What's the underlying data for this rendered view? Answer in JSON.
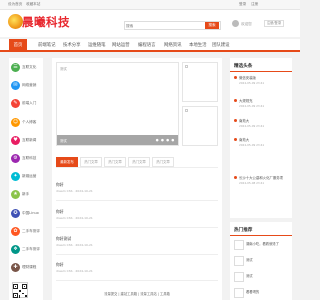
{
  "topbar": {
    "left1": "设为首页",
    "left2": "收藏本站",
    "login": "登录",
    "register": "注册"
  },
  "header": {
    "brand": "晨曦科技",
    "search_placeholder": "搜索",
    "search_button": "搜索",
    "user_text": "欢迎您",
    "user_button": "注册/登录"
  },
  "nav": {
    "items": [
      "首页",
      "前端笔记",
      "技术分享",
      "运维随笔",
      "网站运营",
      "编程语言",
      "网络资讯",
      "本地生活",
      "团队建设"
    ]
  },
  "sidebar": {
    "items": [
      {
        "label": "互联文化",
        "color": "#4caf50",
        "glyph": "☰"
      },
      {
        "label": "网络营销",
        "color": "#2196f3",
        "glyph": "✉"
      },
      {
        "label": "前端入门",
        "color": "#f44336",
        "glyph": "✎"
      },
      {
        "label": "个人博客",
        "color": "#ff9800",
        "glyph": "☺"
      },
      {
        "label": "互联新闻",
        "color": "#e91e63",
        "glyph": "♥"
      },
      {
        "label": "互联科技",
        "color": "#9c27b0",
        "glyph": "⚙"
      },
      {
        "label": "新媒运营",
        "color": "#00bcd4",
        "glyph": "✦"
      },
      {
        "label": "新手",
        "color": "#8bc34a",
        "glyph": "★"
      },
      {
        "label": "中国Linux",
        "color": "#3f51b5",
        "glyph": "✪"
      },
      {
        "label": "二手车测评",
        "color": "#ff5722",
        "glyph": "✿"
      },
      {
        "label": "二手车测评",
        "color": "#009688",
        "glyph": "❖"
      },
      {
        "label": "理财课程",
        "color": "#795548",
        "glyph": "✚"
      }
    ]
  },
  "slider": {
    "alt": "测试",
    "caption": "测试"
  },
  "tabs": [
    "最新发布",
    "热门文章",
    "热门文章",
    "热门文章",
    "热门文章"
  ],
  "posts": [
    {
      "title": "你好",
      "meta": "dream CSS · 2024-10-21"
    },
    {
      "title": "你好",
      "meta": "dream CSS · 2024-10-21"
    },
    {
      "title": "你好测试",
      "meta": "dream CSS · 2024-10-21"
    },
    {
      "title": "你好",
      "meta": "dream CSS · 2024-10-21"
    }
  ],
  "footer": {
    "text": "流量提交 | 建站工具箱 | 流量工具站 | 工具箱"
  },
  "right": {
    "news_title": "精选头条",
    "news": [
      {
        "title": "微信安装版",
        "date": "2024-05-09 23:41"
      },
      {
        "title": "大规规充",
        "date": "2024-05-09 23:41"
      },
      {
        "title": "南苑大",
        "date": "2024-05-09 23:41"
      },
      {
        "title": "南苑大",
        "date": "2024-05-09 23:41"
      },
      {
        "title": "长沙十大公墓和火化厂服务项",
        "date": "2024-05-08 23:41"
      }
    ],
    "hot_title": "热门推荐",
    "hot": [
      {
        "title": "湖南小吃，看着就馋了"
      },
      {
        "title": "测试"
      },
      {
        "title": "测试"
      },
      {
        "title": "看看喝的"
      }
    ]
  }
}
